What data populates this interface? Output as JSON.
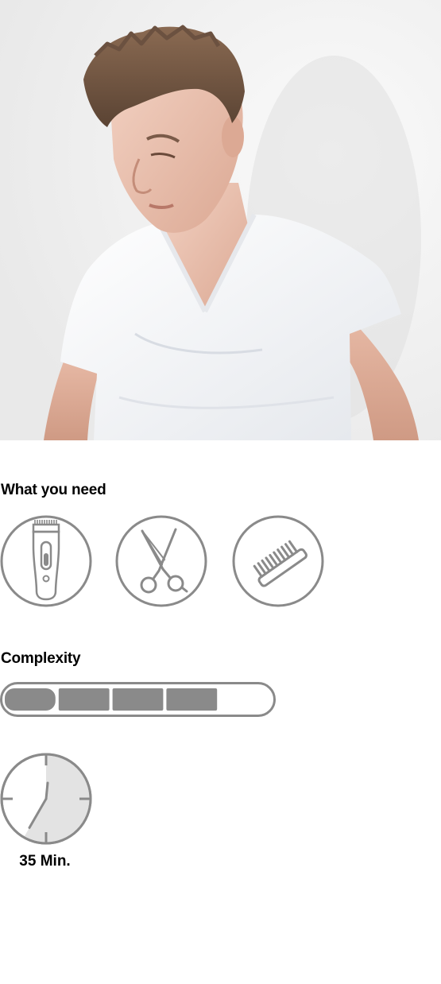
{
  "hero": {
    "image": "man-white-v-neck-tshirt-photo",
    "background_color": "#f1f1f1"
  },
  "tools": {
    "title": "What you need",
    "items": [
      {
        "icon": "hair-clipper-icon"
      },
      {
        "icon": "scissors-icon"
      },
      {
        "icon": "comb-icon"
      }
    ]
  },
  "complexity": {
    "title": "Complexity",
    "level": 4,
    "max_level": 5,
    "fill_color": "#8a8a8a"
  },
  "duration": {
    "icon": "clock-icon",
    "label": "35 Min.",
    "minutes": 35
  },
  "colors": {
    "icon_stroke": "#8a8a8a",
    "clock_fill": "#e3e3e3",
    "text": "#000000"
  }
}
